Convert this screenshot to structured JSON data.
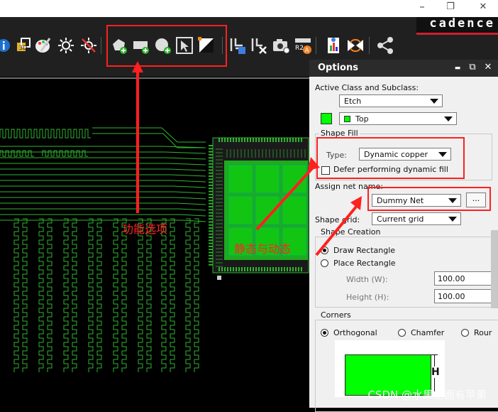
{
  "window": {
    "restore_glyph": "❐",
    "close_glyph": "✕",
    "brand": "cadence"
  },
  "toolbar": {
    "groups": [
      [
        "info-icon",
        "3d-view-icon",
        "color-palette-icon",
        "sun-icon",
        "sun-off-icon"
      ],
      [
        "add-polygon-icon",
        "add-rectangle-icon",
        "add-circle-icon",
        "select-shape-icon",
        "shape-fill-icon"
      ],
      [
        "etch-edit-icon",
        "delete-via-icon",
        "camera-icon",
        "r2a-icon",
        "report-icon",
        "swap-icon",
        "share-icon"
      ]
    ]
  },
  "options_panel": {
    "title": "Options",
    "pin_glyph": "▬",
    "float_glyph": "⧉",
    "close_glyph": "✕",
    "active_class_label": "Active Class and Subclass:",
    "class_value": "Etch",
    "subclass_value": "Top",
    "subclass_color": "#00ff00",
    "shape_fill_label": "Shape Fill",
    "type_label": "Type:",
    "type_value": "Dynamic copper",
    "defer_label": "Defer performing dynamic fill",
    "defer_checked": false,
    "assign_net_label": "Assign net name:",
    "net_value": "Dummy Net",
    "browse_label": "...",
    "shape_grid_label": "Shape grid:",
    "shape_grid_value": "Current grid",
    "shape_creation_label": "Shape Creation",
    "draw_rect_label": "Draw Rectangle",
    "place_rect_label": "Place Rectangle",
    "width_label": "Width (W):",
    "width_value": "100.00",
    "height_label": "Height (H):",
    "height_value": "100.00",
    "corners_label": "Corners",
    "orthogonal_label": "Orthogonal",
    "chamfer_label": "Chamfer",
    "round_label": "Rour",
    "preview_h_label": "H"
  },
  "annotations": {
    "function_options": "功能选项",
    "static_dynamic": "静态与动态",
    "accent": "#ff2020"
  },
  "watermark": "CSDN @水果里面有苹果"
}
